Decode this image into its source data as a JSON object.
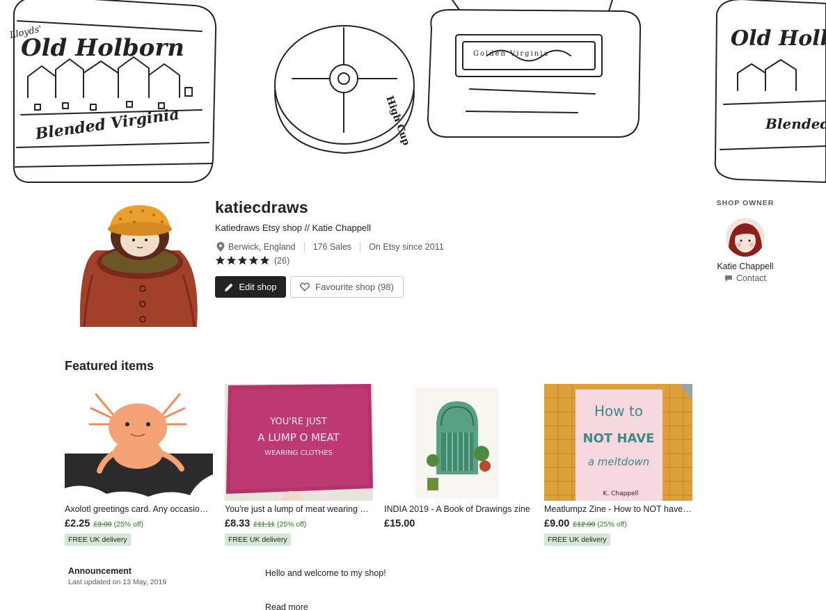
{
  "banner": {
    "tin_labels": [
      "Lloyds'",
      "Old Holborn",
      "Blended Virginia",
      "Golden Virginia",
      "High Cup"
    ]
  },
  "shop": {
    "name": "katiecdraws",
    "title": "Katiedraws Etsy shop // Katie Chappell",
    "location": "Berwick, England",
    "sales": "176 Sales",
    "since": "On Etsy since 2011",
    "rating": 5,
    "rating_count": "(26)",
    "edit_label": "Edit shop",
    "favourite_label": "Favourite shop (98)"
  },
  "owner": {
    "heading": "SHOP OWNER",
    "name": "Katie Chappell",
    "contact_label": "Contact"
  },
  "featured": {
    "heading": "Featured items",
    "items": [
      {
        "title": "Axolotl greetings card. Any occasion card",
        "price": "£2.25",
        "original": "£3.00",
        "discount": "(25% off)",
        "badge": "FREE UK delivery"
      },
      {
        "title": "You're just a lump of meat wearing clothes print",
        "price": "£8.33",
        "original": "£11.11",
        "discount": "(25% off)",
        "badge": "FREE UK delivery"
      },
      {
        "title": "INDIA 2019 - A Book of Drawings zine",
        "price": "£15.00",
        "original": "",
        "discount": "",
        "badge": ""
      },
      {
        "title": "Meatlumpz Zine - How to NOT have a meltdown",
        "price": "£9.00",
        "original": "£12.00",
        "discount": "(25% off)",
        "badge": "FREE UK delivery"
      }
    ],
    "art_text": {
      "meat_line1": "YOU'RE JUST",
      "meat_line2": "A LUMP O MEAT",
      "meat_line3": "WEARING CLOTHES",
      "zine_line1": "How to",
      "zine_line2": "NOT HAVE",
      "zine_line3": "a meltdown",
      "zine_author": "K. Chappell"
    }
  },
  "announcement": {
    "title": "Announcement",
    "updated": "Last updated on 13 May, 2019",
    "body": "Hello and welcome to my shop!",
    "read_more": "Read more"
  },
  "colors": {
    "primary_button": "#222222",
    "sale_green": "#2a7a2a",
    "badge_bg": "#d4e9d5"
  }
}
